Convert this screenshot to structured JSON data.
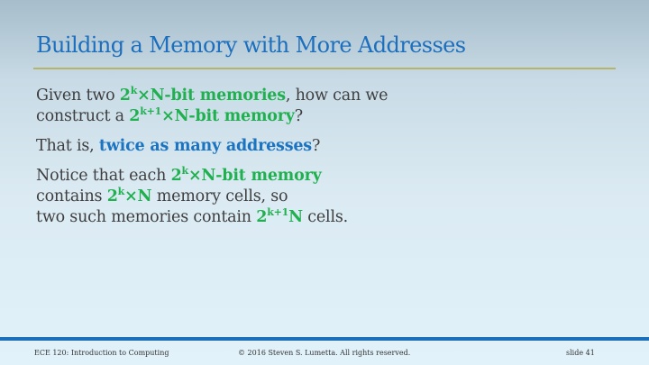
{
  "title": "Building a Memory with More Addresses",
  "p1": {
    "a": "Given two ",
    "e1_base": "2",
    "e1_sup": "k",
    "e1_rest": "×N-bit memories",
    "b": ", how can we",
    "c": "construct a ",
    "e2_base": "2",
    "e2_sup": "k+1",
    "e2_rest": "×N-bit memory",
    "d": "?"
  },
  "p2": {
    "a": "That is, ",
    "emph": "twice as many addresses",
    "b": "?"
  },
  "p3": {
    "a": "Notice that each ",
    "e1_base": "2",
    "e1_sup": "k",
    "e1_rest": "×N-bit memory",
    "b": "contains ",
    "e2_base": "2",
    "e2_sup": "k",
    "e2_rest": "×N",
    "c": " memory cells, so",
    "d": "two such memories contain ",
    "e3_base": "2",
    "e3_sup": "k+1",
    "e3_rest": "N",
    "e": " cells."
  },
  "footer": {
    "course": "ECE 120: Introduction to Computing",
    "copyright": "© 2016 Steven S. Lumetta.  All rights reserved.",
    "slide": "slide 41"
  }
}
